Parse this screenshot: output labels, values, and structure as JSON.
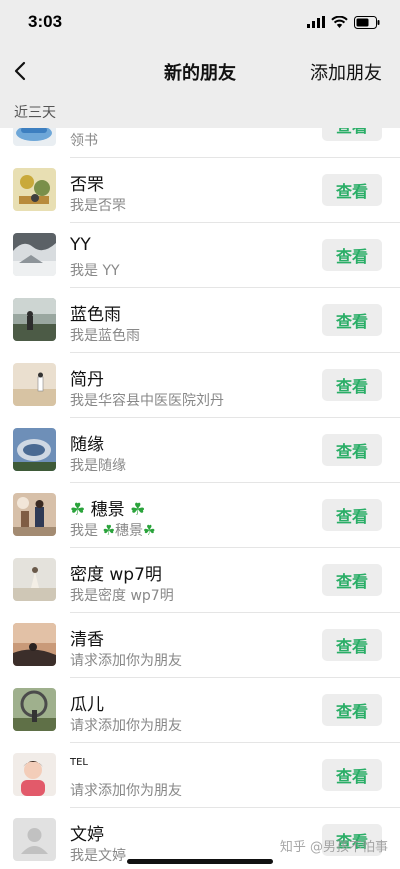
{
  "status": {
    "time": "3:03"
  },
  "nav": {
    "title": "新的朋友",
    "action_label": "添加朋友"
  },
  "section": {
    "label": "近三天"
  },
  "view_label": "查看",
  "rows": [
    {
      "name": "",
      "subtitle": "领书"
    },
    {
      "name": "否罘",
      "subtitle": "我是否罘"
    },
    {
      "name": "YY",
      "subtitle": "我是 YY"
    },
    {
      "name": "蓝色雨",
      "subtitle": "我是蓝色雨"
    },
    {
      "name": "简丹",
      "subtitle": "我是华容县中医医院刘丹"
    },
    {
      "name": "随缘",
      "subtitle": "我是随缘"
    },
    {
      "name": "穗景",
      "subtitle_prefix": "我是 ",
      "subtitle": "穗景"
    },
    {
      "name": "密度 wp7明",
      "subtitle": "我是密度 wp7明"
    },
    {
      "name": "清香",
      "subtitle": "请求添加你为朋友"
    },
    {
      "name": "瓜儿",
      "subtitle": "请求添加你为朋友"
    },
    {
      "name": "TEL",
      "subtitle": "请求添加你为朋友"
    },
    {
      "name": "文婷",
      "subtitle": "我是文婷"
    }
  ],
  "watermark": "知乎 @男孩不怕事",
  "colors": {
    "accent_green": "#2aae67",
    "nav_bg": "#ededed"
  }
}
